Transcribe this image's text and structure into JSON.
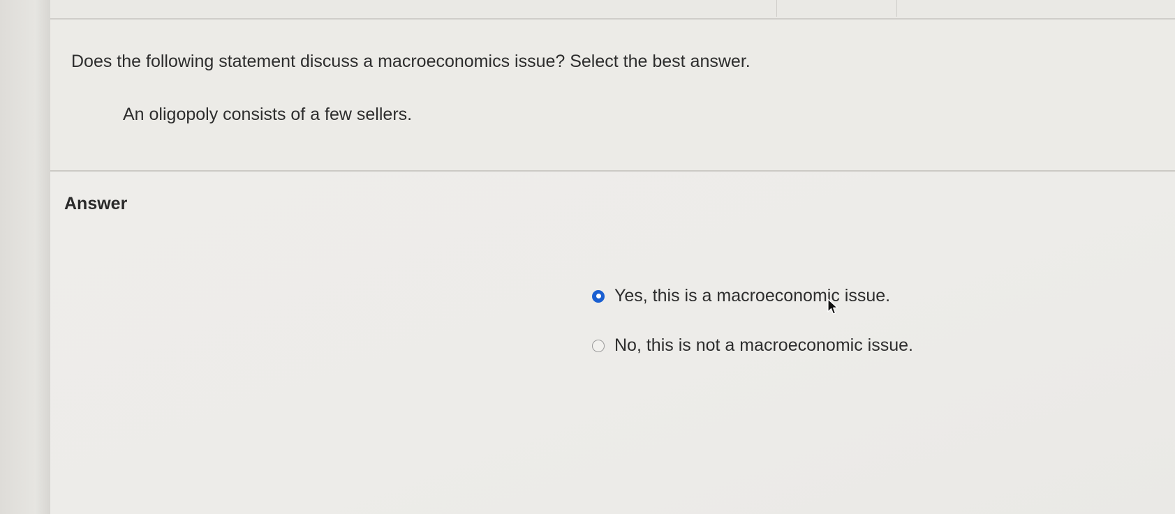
{
  "question": {
    "prompt": "Does the following statement discuss a macroeconomics issue? Select the best answer.",
    "statement": "An oligopoly consists of a few sellers."
  },
  "answer": {
    "heading": "Answer",
    "options": [
      {
        "label": "Yes, this is a macroeconomic issue.",
        "selected": true
      },
      {
        "label": "No, this is not a macroeconomic issue.",
        "selected": false
      }
    ]
  },
  "colors": {
    "radio_selected": "#1a5fd1",
    "text": "#2d2d2d"
  },
  "icons": {
    "cursor": "mouse-pointer-icon"
  }
}
